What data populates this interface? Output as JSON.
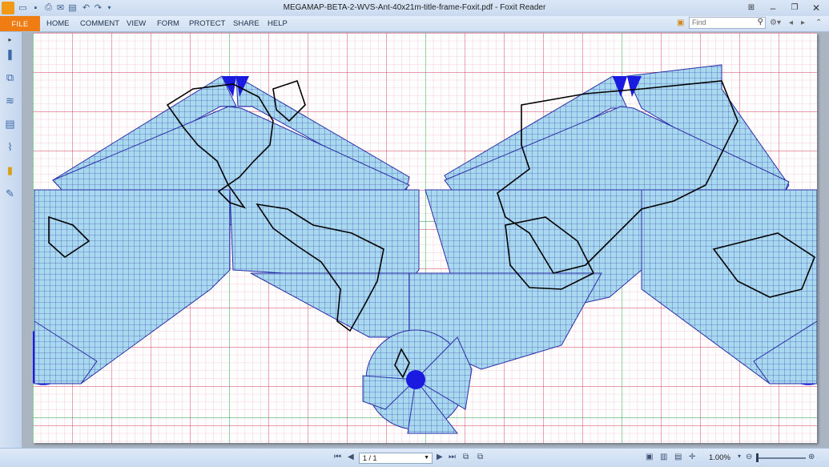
{
  "window": {
    "title": "MEGAMAP-BETA-2-WVS-Ant-40x21m-title-frame-Foxit.pdf - Foxit Reader"
  },
  "quick_access": [
    "folder-open-icon",
    "save-icon",
    "print-icon",
    "email-icon",
    "export-icon",
    "undo-icon",
    "redo-icon",
    "customize-icon"
  ],
  "menu": {
    "file": "FILE",
    "items": [
      "HOME",
      "COMMENT",
      "VIEW",
      "FORM",
      "PROTECT",
      "SHARE",
      "HELP"
    ]
  },
  "find": {
    "placeholder": "Find"
  },
  "sidebar_icons": [
    "bookmark-icon",
    "pages-icon",
    "layers-icon",
    "comments-icon",
    "attachments-icon",
    "security-icon",
    "signatures-icon"
  ],
  "status": {
    "page_field": "1 / 1",
    "zoom": "1.00%"
  },
  "colors": {
    "accent_orange": "#f07c14",
    "ocean_fill": "#a9d9ef",
    "graticule": "#2a2fa8",
    "grid_red": "#d33c5e",
    "grid_green": "#2aa84a"
  }
}
